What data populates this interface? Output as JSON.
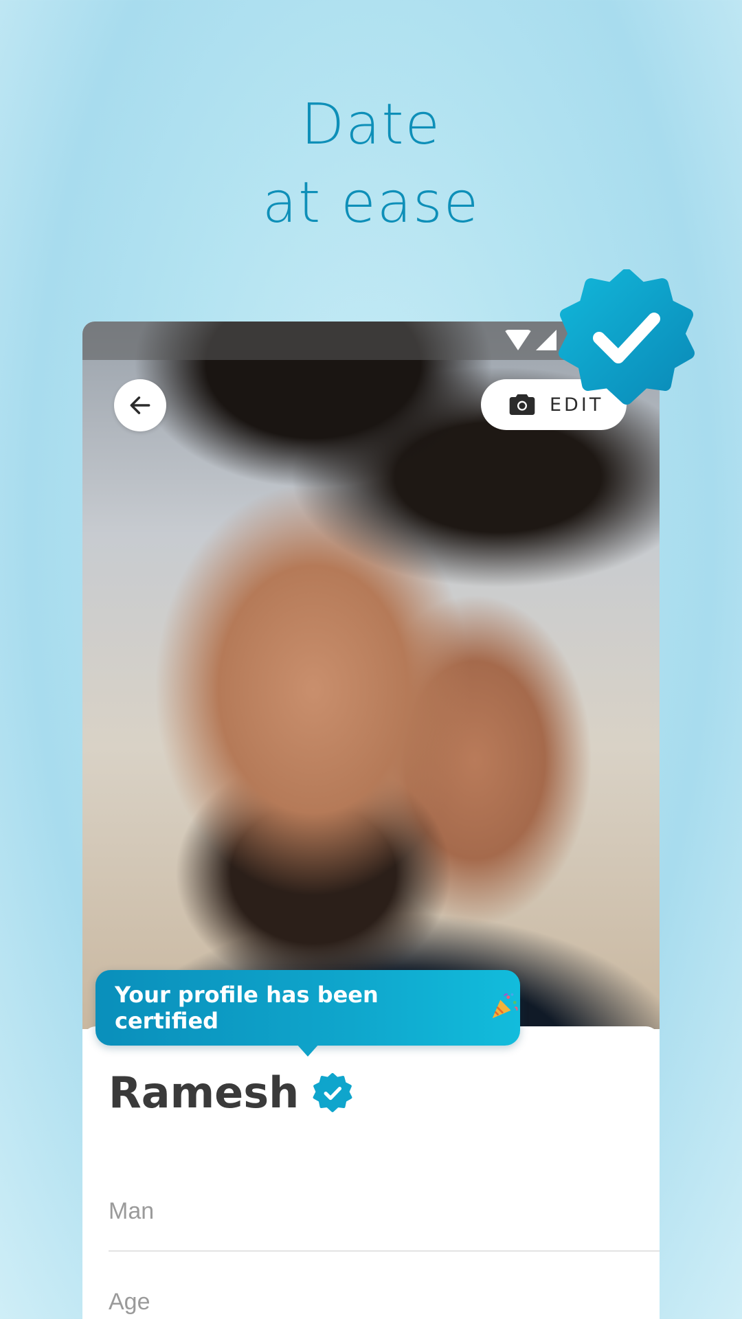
{
  "headline": {
    "line1": "Date",
    "line2": "at ease"
  },
  "profile": {
    "name": "Ramesh",
    "fields": [
      {
        "label": "Man"
      },
      {
        "label": "Age"
      }
    ]
  },
  "toolbar": {
    "edit_label": "EDIT"
  },
  "tooltip": {
    "text": "Your profile has been certified"
  },
  "icons": {
    "back": "arrow-left-icon",
    "edit": "camera-icon",
    "verified": "verified-badge-icon",
    "confetti": "party-popper-icon",
    "wifi": "wifi-icon",
    "signal": "cell-signal-icon"
  },
  "colors": {
    "accent": "#0e8fb8",
    "badge": "#0fa5cc",
    "name_text": "#3a3a3a",
    "field_label": "#9a9a9a"
  }
}
